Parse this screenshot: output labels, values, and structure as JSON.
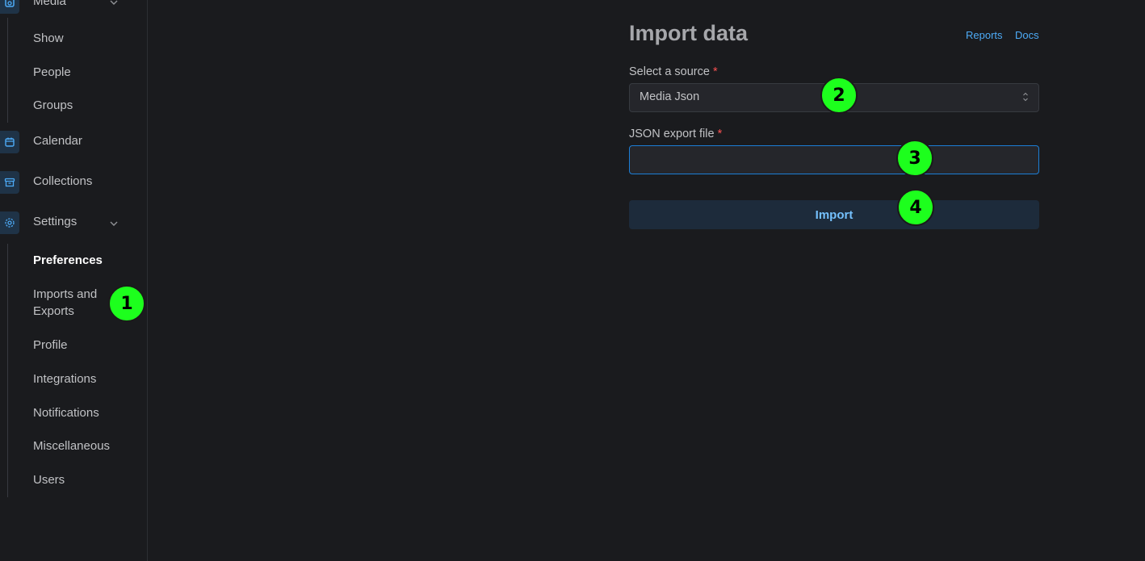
{
  "sidebar": {
    "media": {
      "label": "Media",
      "icon": "media-icon"
    },
    "media_items": [
      "Show",
      "People",
      "Groups"
    ],
    "calendar": {
      "label": "Calendar",
      "icon": "calendar-icon"
    },
    "collections": {
      "label": "Collections",
      "icon": "archive-icon"
    },
    "settings": {
      "label": "Settings",
      "icon": "gear-icon"
    },
    "settings_items": [
      "Preferences",
      "Imports and Exports",
      "Profile",
      "Integrations",
      "Notifications",
      "Miscellaneous",
      "Users"
    ]
  },
  "main": {
    "title": "Import data",
    "links": {
      "reports": "Reports",
      "docs": "Docs"
    },
    "source": {
      "label": "Select a source",
      "required_mark": "*",
      "value": "Media Json"
    },
    "file": {
      "label": "JSON export file",
      "required_mark": "*",
      "value": ""
    },
    "import_button": "Import"
  },
  "markers": [
    "1",
    "2",
    "3",
    "4"
  ],
  "colors": {
    "accent": "#4dabf7",
    "marker": "#1dff1d",
    "background": "#1a1b1e",
    "required": "#fa5252"
  }
}
